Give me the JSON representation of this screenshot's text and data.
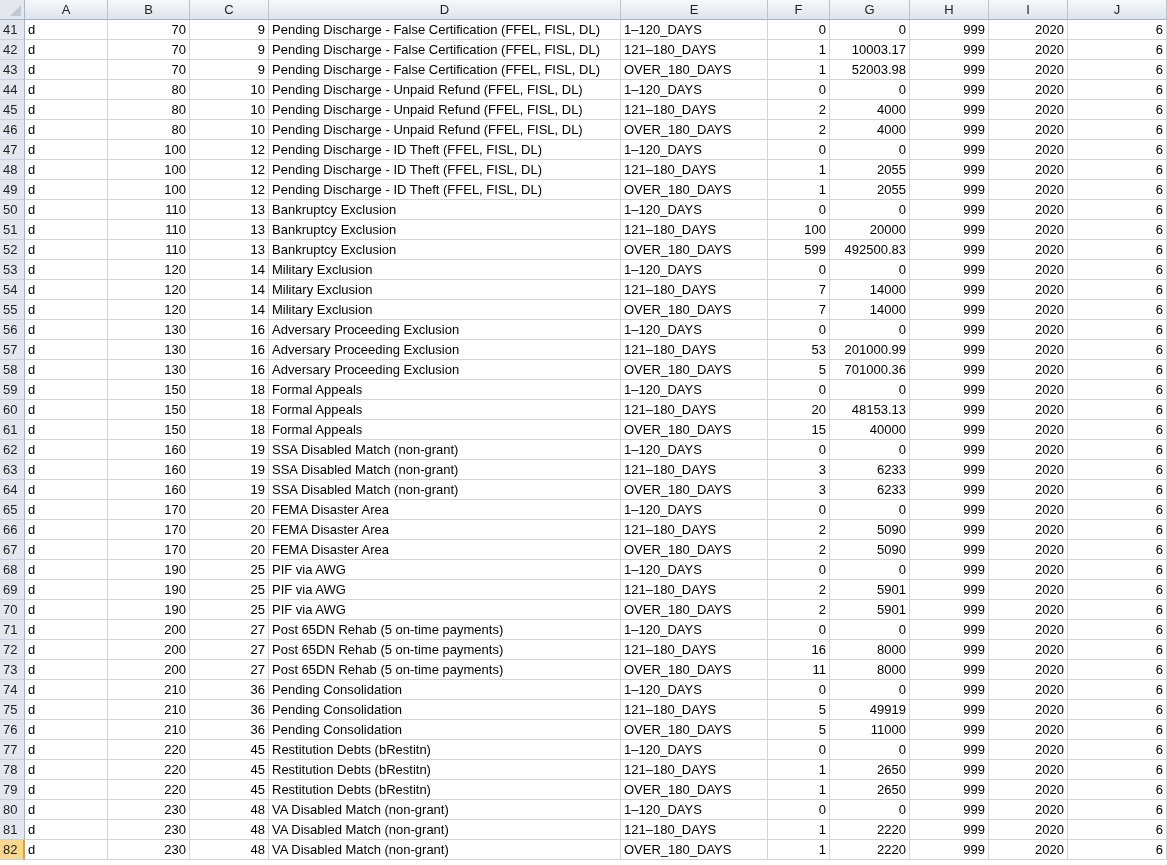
{
  "columns": [
    {
      "label": "A",
      "kind": "text"
    },
    {
      "label": "B",
      "kind": "number"
    },
    {
      "label": "C",
      "kind": "number"
    },
    {
      "label": "D",
      "kind": "text"
    },
    {
      "label": "E",
      "kind": "text"
    },
    {
      "label": "F",
      "kind": "number"
    },
    {
      "label": "G",
      "kind": "number"
    },
    {
      "label": "H",
      "kind": "number"
    },
    {
      "label": "I",
      "kind": "number"
    },
    {
      "label": "J",
      "kind": "number"
    }
  ],
  "rows": [
    {
      "num": "41",
      "selected": false,
      "cells": [
        "d",
        "70",
        "9",
        "Pending Discharge - False Certification (FFEL, FISL, DL)",
        "1–120_DAYS",
        "0",
        "0",
        "999",
        "2020",
        "6"
      ]
    },
    {
      "num": "42",
      "selected": false,
      "cells": [
        "d",
        "70",
        "9",
        "Pending Discharge - False Certification (FFEL, FISL, DL)",
        "121–180_DAYS",
        "1",
        "10003.17",
        "999",
        "2020",
        "6"
      ]
    },
    {
      "num": "43",
      "selected": false,
      "cells": [
        "d",
        "70",
        "9",
        "Pending Discharge - False Certification (FFEL, FISL, DL)",
        "OVER_180_DAYS",
        "1",
        "52003.98",
        "999",
        "2020",
        "6"
      ]
    },
    {
      "num": "44",
      "selected": false,
      "cells": [
        "d",
        "80",
        "10",
        "Pending Discharge - Unpaid Refund (FFEL, FISL, DL)",
        "1–120_DAYS",
        "0",
        "0",
        "999",
        "2020",
        "6"
      ]
    },
    {
      "num": "45",
      "selected": false,
      "cells": [
        "d",
        "80",
        "10",
        "Pending Discharge - Unpaid Refund (FFEL, FISL, DL)",
        "121–180_DAYS",
        "2",
        "4000",
        "999",
        "2020",
        "6"
      ]
    },
    {
      "num": "46",
      "selected": false,
      "cells": [
        "d",
        "80",
        "10",
        "Pending Discharge - Unpaid Refund (FFEL, FISL, DL)",
        "OVER_180_DAYS",
        "2",
        "4000",
        "999",
        "2020",
        "6"
      ]
    },
    {
      "num": "47",
      "selected": false,
      "cells": [
        "d",
        "100",
        "12",
        "Pending Discharge - ID Theft (FFEL, FISL, DL)",
        "1–120_DAYS",
        "0",
        "0",
        "999",
        "2020",
        "6"
      ]
    },
    {
      "num": "48",
      "selected": false,
      "cells": [
        "d",
        "100",
        "12",
        "Pending Discharge - ID Theft (FFEL, FISL, DL)",
        "121–180_DAYS",
        "1",
        "2055",
        "999",
        "2020",
        "6"
      ]
    },
    {
      "num": "49",
      "selected": false,
      "cells": [
        "d",
        "100",
        "12",
        "Pending Discharge - ID Theft (FFEL, FISL, DL)",
        "OVER_180_DAYS",
        "1",
        "2055",
        "999",
        "2020",
        "6"
      ]
    },
    {
      "num": "50",
      "selected": false,
      "cells": [
        "d",
        "110",
        "13",
        "Bankruptcy Exclusion",
        "1–120_DAYS",
        "0",
        "0",
        "999",
        "2020",
        "6"
      ]
    },
    {
      "num": "51",
      "selected": false,
      "cells": [
        "d",
        "110",
        "13",
        "Bankruptcy Exclusion",
        "121–180_DAYS",
        "100",
        "20000",
        "999",
        "2020",
        "6"
      ]
    },
    {
      "num": "52",
      "selected": false,
      "cells": [
        "d",
        "110",
        "13",
        "Bankruptcy Exclusion",
        "OVER_180_DAYS",
        "599",
        "492500.83",
        "999",
        "2020",
        "6"
      ]
    },
    {
      "num": "53",
      "selected": false,
      "cells": [
        "d",
        "120",
        "14",
        "Military Exclusion",
        "1–120_DAYS",
        "0",
        "0",
        "999",
        "2020",
        "6"
      ]
    },
    {
      "num": "54",
      "selected": false,
      "cells": [
        "d",
        "120",
        "14",
        "Military Exclusion",
        "121–180_DAYS",
        "7",
        "14000",
        "999",
        "2020",
        "6"
      ]
    },
    {
      "num": "55",
      "selected": false,
      "cells": [
        "d",
        "120",
        "14",
        "Military Exclusion",
        "OVER_180_DAYS",
        "7",
        "14000",
        "999",
        "2020",
        "6"
      ]
    },
    {
      "num": "56",
      "selected": false,
      "cells": [
        "d",
        "130",
        "16",
        "Adversary Proceeding Exclusion",
        "1–120_DAYS",
        "0",
        "0",
        "999",
        "2020",
        "6"
      ]
    },
    {
      "num": "57",
      "selected": false,
      "cells": [
        "d",
        "130",
        "16",
        "Adversary Proceeding Exclusion",
        "121–180_DAYS",
        "53",
        "201000.99",
        "999",
        "2020",
        "6"
      ]
    },
    {
      "num": "58",
      "selected": false,
      "cells": [
        "d",
        "130",
        "16",
        "Adversary Proceeding Exclusion",
        "OVER_180_DAYS",
        "5",
        "701000.36",
        "999",
        "2020",
        "6"
      ]
    },
    {
      "num": "59",
      "selected": false,
      "cells": [
        "d",
        "150",
        "18",
        "Formal Appeals",
        "1–120_DAYS",
        "0",
        "0",
        "999",
        "2020",
        "6"
      ]
    },
    {
      "num": "60",
      "selected": false,
      "cells": [
        "d",
        "150",
        "18",
        "Formal Appeals",
        "121–180_DAYS",
        "20",
        "48153.13",
        "999",
        "2020",
        "6"
      ]
    },
    {
      "num": "61",
      "selected": false,
      "cells": [
        "d",
        "150",
        "18",
        "Formal Appeals",
        "OVER_180_DAYS",
        "15",
        "40000",
        "999",
        "2020",
        "6"
      ]
    },
    {
      "num": "62",
      "selected": false,
      "cells": [
        "d",
        "160",
        "19",
        "SSA Disabled Match (non-grant)",
        "1–120_DAYS",
        "0",
        "0",
        "999",
        "2020",
        "6"
      ]
    },
    {
      "num": "63",
      "selected": false,
      "cells": [
        "d",
        "160",
        "19",
        "SSA Disabled Match (non-grant)",
        "121–180_DAYS",
        "3",
        "6233",
        "999",
        "2020",
        "6"
      ]
    },
    {
      "num": "64",
      "selected": false,
      "cells": [
        "d",
        "160",
        "19",
        "SSA Disabled Match (non-grant)",
        "OVER_180_DAYS",
        "3",
        "6233",
        "999",
        "2020",
        "6"
      ]
    },
    {
      "num": "65",
      "selected": false,
      "cells": [
        "d",
        "170",
        "20",
        "FEMA Disaster Area",
        "1–120_DAYS",
        "0",
        "0",
        "999",
        "2020",
        "6"
      ]
    },
    {
      "num": "66",
      "selected": false,
      "cells": [
        "d",
        "170",
        "20",
        "FEMA Disaster Area",
        "121–180_DAYS",
        "2",
        "5090",
        "999",
        "2020",
        "6"
      ]
    },
    {
      "num": "67",
      "selected": false,
      "cells": [
        "d",
        "170",
        "20",
        "FEMA Disaster Area",
        "OVER_180_DAYS",
        "2",
        "5090",
        "999",
        "2020",
        "6"
      ]
    },
    {
      "num": "68",
      "selected": false,
      "cells": [
        "d",
        "190",
        "25",
        "PIF via AWG",
        "1–120_DAYS",
        "0",
        "0",
        "999",
        "2020",
        "6"
      ]
    },
    {
      "num": "69",
      "selected": false,
      "cells": [
        "d",
        "190",
        "25",
        "PIF via AWG",
        "121–180_DAYS",
        "2",
        "5901",
        "999",
        "2020",
        "6"
      ]
    },
    {
      "num": "70",
      "selected": false,
      "cells": [
        "d",
        "190",
        "25",
        "PIF via AWG",
        "OVER_180_DAYS",
        "2",
        "5901",
        "999",
        "2020",
        "6"
      ]
    },
    {
      "num": "71",
      "selected": false,
      "cells": [
        "d",
        "200",
        "27",
        "Post 65DN Rehab (5 on-time payments)",
        "1–120_DAYS",
        "0",
        "0",
        "999",
        "2020",
        "6"
      ]
    },
    {
      "num": "72",
      "selected": false,
      "cells": [
        "d",
        "200",
        "27",
        "Post 65DN Rehab (5 on-time payments)",
        "121–180_DAYS",
        "16",
        "8000",
        "999",
        "2020",
        "6"
      ]
    },
    {
      "num": "73",
      "selected": false,
      "cells": [
        "d",
        "200",
        "27",
        "Post 65DN Rehab (5 on-time payments)",
        "OVER_180_DAYS",
        "11",
        "8000",
        "999",
        "2020",
        "6"
      ]
    },
    {
      "num": "74",
      "selected": false,
      "cells": [
        "d",
        "210",
        "36",
        "Pending Consolidation",
        "1–120_DAYS",
        "0",
        "0",
        "999",
        "2020",
        "6"
      ]
    },
    {
      "num": "75",
      "selected": false,
      "cells": [
        "d",
        "210",
        "36",
        "Pending Consolidation",
        "121–180_DAYS",
        "5",
        "49919",
        "999",
        "2020",
        "6"
      ]
    },
    {
      "num": "76",
      "selected": false,
      "cells": [
        "d",
        "210",
        "36",
        "Pending Consolidation",
        "OVER_180_DAYS",
        "5",
        "11000",
        "999",
        "2020",
        "6"
      ]
    },
    {
      "num": "77",
      "selected": false,
      "cells": [
        "d",
        "220",
        "45",
        "Restitution Debts (bRestitn)",
        "1–120_DAYS",
        "0",
        "0",
        "999",
        "2020",
        "6"
      ]
    },
    {
      "num": "78",
      "selected": false,
      "cells": [
        "d",
        "220",
        "45",
        "Restitution Debts (bRestitn)",
        "121–180_DAYS",
        "1",
        "2650",
        "999",
        "2020",
        "6"
      ]
    },
    {
      "num": "79",
      "selected": false,
      "cells": [
        "d",
        "220",
        "45",
        "Restitution Debts (bRestitn)",
        "OVER_180_DAYS",
        "1",
        "2650",
        "999",
        "2020",
        "6"
      ]
    },
    {
      "num": "80",
      "selected": false,
      "cells": [
        "d",
        "230",
        "48",
        "VA Disabled Match (non-grant)",
        "1–120_DAYS",
        "0",
        "0",
        "999",
        "2020",
        "6"
      ]
    },
    {
      "num": "81",
      "selected": false,
      "cells": [
        "d",
        "230",
        "48",
        "VA Disabled Match (non-grant)",
        "121–180_DAYS",
        "1",
        "2220",
        "999",
        "2020",
        "6"
      ]
    },
    {
      "num": "82",
      "selected": true,
      "cells": [
        "d",
        "230",
        "48",
        "VA Disabled Match (non-grant)",
        "OVER_180_DAYS",
        "1",
        "2220",
        "999",
        "2020",
        "6"
      ]
    }
  ]
}
